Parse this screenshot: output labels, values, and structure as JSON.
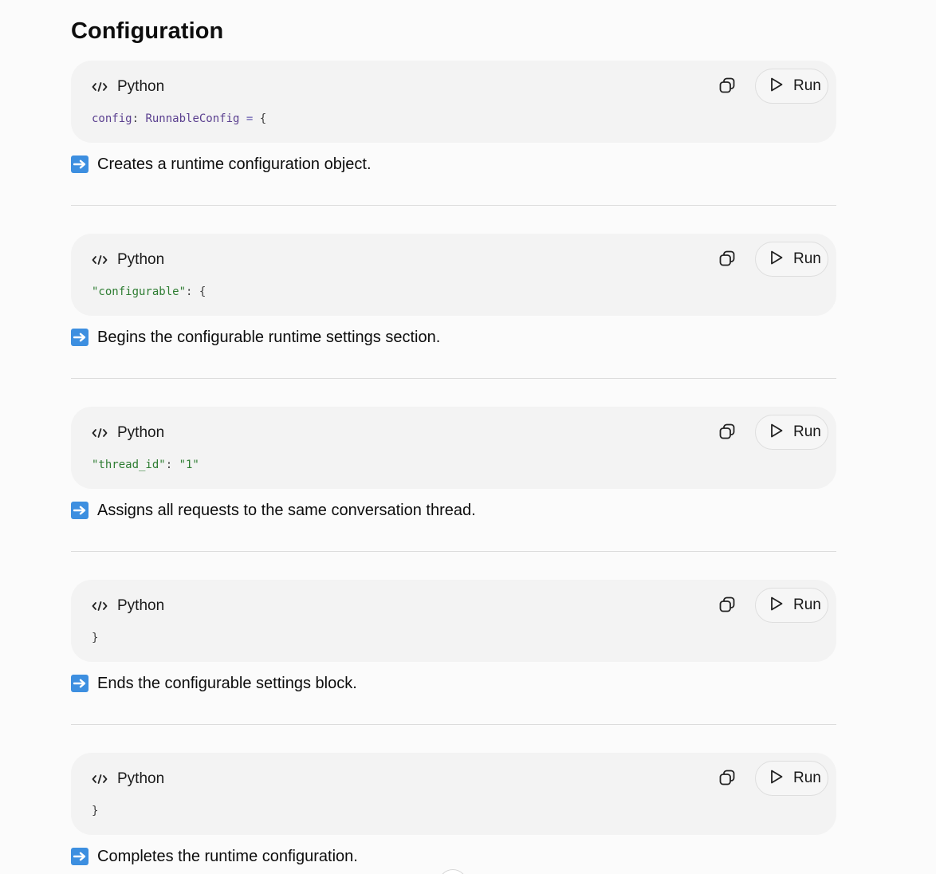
{
  "section": {
    "title": "Configuration"
  },
  "blocks": [
    {
      "language": "Python",
      "run_label": "Run",
      "code": [
        {
          "text": "config",
          "kind": "var"
        },
        {
          "text": ": ",
          "kind": "punc"
        },
        {
          "text": "RunnableConfig",
          "kind": "type"
        },
        {
          "text": " = ",
          "kind": "op"
        },
        {
          "text": "{",
          "kind": "punc"
        }
      ],
      "description": "Creates a runtime configuration object."
    },
    {
      "language": "Python",
      "run_label": "Run",
      "code": [
        {
          "text": "\"configurable\"",
          "kind": "str"
        },
        {
          "text": ": {",
          "kind": "punc"
        }
      ],
      "description": "Begins the configurable runtime settings section."
    },
    {
      "language": "Python",
      "run_label": "Run",
      "code": [
        {
          "text": "\"thread_id\"",
          "kind": "str"
        },
        {
          "text": ": ",
          "kind": "punc"
        },
        {
          "text": "\"1\"",
          "kind": "str"
        }
      ],
      "description": "Assigns all requests to the same conversation thread."
    },
    {
      "language": "Python",
      "run_label": "Run",
      "code": [
        {
          "text": "}",
          "kind": "punc"
        }
      ],
      "description": "Ends the configurable settings block."
    },
    {
      "language": "Python",
      "run_label": "Run",
      "code": [
        {
          "text": "}",
          "kind": "punc"
        }
      ],
      "description": "Completes the runtime configuration."
    }
  ],
  "icons": {
    "language": "code-icon",
    "copy": "copy-icon",
    "run": "play-icon",
    "description": "right-arrow-emoji-icon"
  },
  "colors": {
    "page_background": "#fbfbfb",
    "code_background": "#f3f3f3",
    "emoji_blue": "#3d8fe0",
    "string": "#2e7d32",
    "identifier": "#5a3f8f"
  }
}
